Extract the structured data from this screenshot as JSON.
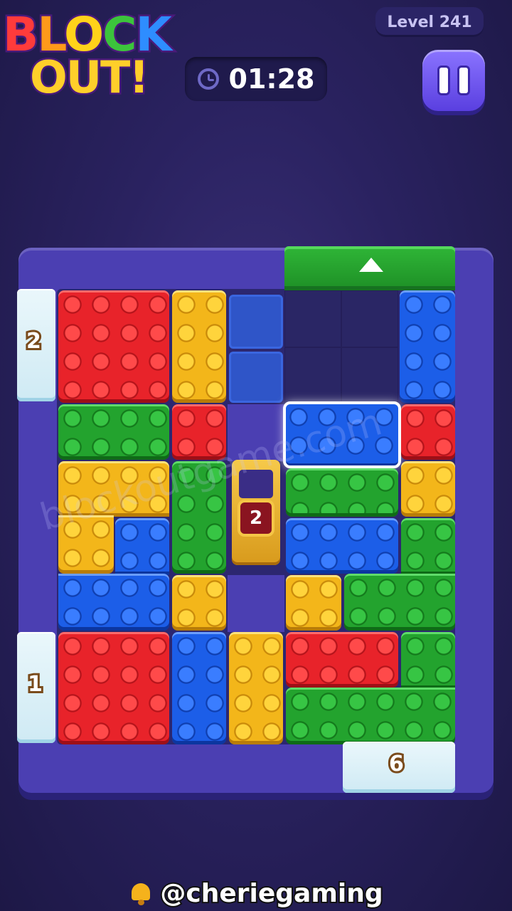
{
  "header": {
    "logo_line1": [
      "B",
      "L",
      "O",
      "C",
      "K"
    ],
    "logo_line2": "OUT!",
    "level_label": "Level 241",
    "timer": "01:28"
  },
  "board": {
    "exit_top_color": "green",
    "ice_gates": [
      {
        "id": "left-top",
        "count": "2"
      },
      {
        "id": "left-bottom",
        "count": "1"
      },
      {
        "id": "bottom-right",
        "count": "6"
      }
    ],
    "locked_door_count": "2"
  },
  "watermark": "blockoutgame.com",
  "footer": {
    "handle": "@cheriegaming"
  },
  "colors": {
    "red": "#e8232a",
    "yellow": "#f3b61a",
    "green": "#23a32e",
    "blue": "#1c5ee8",
    "frame": "#4b3fb2"
  },
  "icons": [
    "timer-icon",
    "pause-icon",
    "arrow-up-icon",
    "bell-icon"
  ]
}
